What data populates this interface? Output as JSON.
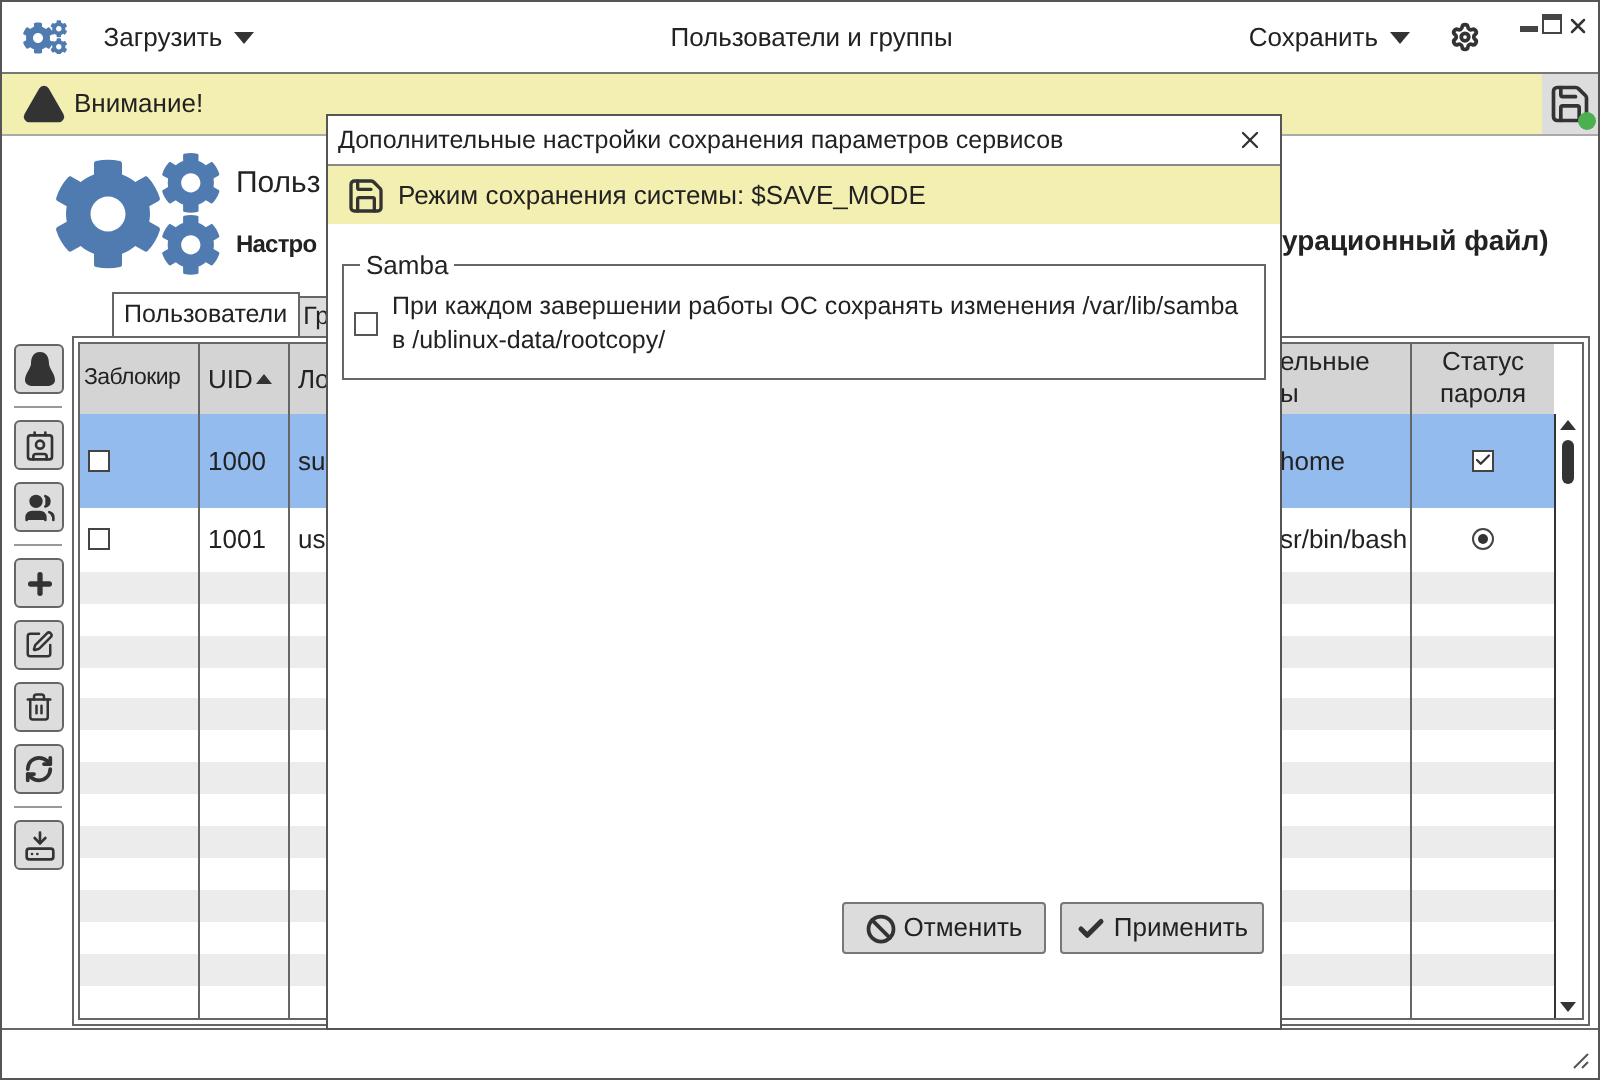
{
  "window": {
    "title": "Пользователи и группы",
    "load_menu": "Загрузить",
    "save_menu": "Сохранить"
  },
  "warning": {
    "text": "Внимание!"
  },
  "header": {
    "title": "Польз",
    "subtitle": "Настро",
    "subtitle_tail": "урационный файл)"
  },
  "tabs": [
    {
      "label": "Пользователи",
      "selected": true
    },
    {
      "label": "Гр",
      "selected": false
    }
  ],
  "table": {
    "columns": [
      {
        "label": "Заблокир"
      },
      {
        "label": "UID",
        "sort_ascending": true
      },
      {
        "label": "Ло"
      },
      {
        "lines": [
          "ельные",
          "ы"
        ]
      },
      {
        "label": "Статус пароля"
      }
    ],
    "rows": [
      {
        "selected": true,
        "locked": false,
        "uid": "1000",
        "column_3": "su",
        "column_7": "home",
        "password": {
          "kind": "checkbox",
          "checked": true
        }
      },
      {
        "selected": false,
        "locked": false,
        "uid": "1001",
        "column_3": "us",
        "column_7": "sr/bin/bash",
        "password": {
          "kind": "radio",
          "checked": true
        }
      }
    ]
  },
  "dialog": {
    "title": "Дополнительные настройки сохранения параметров сервисов",
    "mode_text": "Режим сохранения системы: $SAVE_MODE",
    "groups": [
      {
        "title": "Samba",
        "options": [
          {
            "label": "При каждом завершении работы ОС сохранять изменения /var/lib/samba в /ublinux-data/rootcopy/",
            "checked": false
          }
        ]
      }
    ],
    "buttons": [
      {
        "label": "Отменить",
        "kind": "cancel"
      },
      {
        "label": "Применить",
        "kind": "apply"
      }
    ]
  }
}
